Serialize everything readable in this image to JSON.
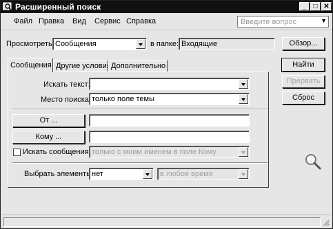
{
  "window": {
    "title": "Расширенный поиск"
  },
  "title_buttons": {
    "minimize": "_",
    "maximize": "□",
    "close": "✕"
  },
  "menu": [
    "Файл",
    "Правка",
    "Вид",
    "Сервис",
    "Справка"
  ],
  "help_search": {
    "placeholder": "Введите вопрос"
  },
  "browse": {
    "label": "Просмотреть:",
    "value": "Сообщения",
    "folder_label": "в папке:",
    "folder_value": "Входящие",
    "browse_button": "Обзор..."
  },
  "tabs": [
    "Сообщения",
    "Другие условия",
    "Дополнительно"
  ],
  "actions": {
    "find": "Найти",
    "stop": "Прервать",
    "reset": "Сброс"
  },
  "form": {
    "search_text_label": "Искать текст:",
    "search_text_value": "",
    "search_in_label": "Место поиска:",
    "search_in_value": "только поле темы",
    "from_button": "От ...",
    "from_value": "",
    "to_button": "Кому ...",
    "to_value": "",
    "where_label": "Искать сообщения:",
    "where_value": "только с моим именем в поле Кому",
    "time_label": "Выбрать элементы:",
    "time_value": "нет",
    "time_range": "в любое время"
  },
  "icons": {
    "app": "search-app-icon",
    "magnifier": "magnifier-icon",
    "grip": "resize-grip-icon"
  },
  "colors": {
    "titlebar": "#101010",
    "face": "#e6e6e6"
  }
}
